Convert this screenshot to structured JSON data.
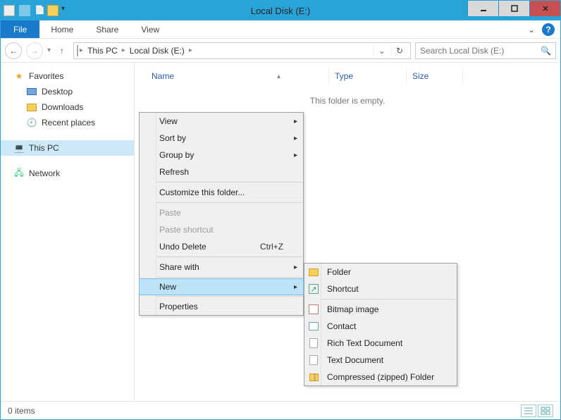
{
  "window": {
    "title": "Local Disk (E:)"
  },
  "ribbon": {
    "file": "File",
    "tabs": [
      "Home",
      "Share",
      "View"
    ]
  },
  "nav": {
    "crumbs": [
      "This PC",
      "Local Disk (E:)"
    ],
    "search_placeholder": "Search Local Disk (E:)"
  },
  "sidebar": {
    "favorites": {
      "label": "Favorites",
      "items": [
        "Desktop",
        "Downloads",
        "Recent places"
      ]
    },
    "thispc": {
      "label": "This PC"
    },
    "network": {
      "label": "Network"
    }
  },
  "columns": {
    "name": "Name",
    "type": "Type",
    "size": "Size"
  },
  "content": {
    "empty": "This folder is empty."
  },
  "context": {
    "view": "View",
    "sortby": "Sort by",
    "groupby": "Group by",
    "refresh": "Refresh",
    "customize": "Customize this folder...",
    "paste": "Paste",
    "paste_shortcut": "Paste shortcut",
    "undo": "Undo Delete",
    "undo_accel": "Ctrl+Z",
    "sharewith": "Share with",
    "new": "New",
    "properties": "Properties"
  },
  "new_submenu": {
    "folder": "Folder",
    "shortcut": "Shortcut",
    "bitmap": "Bitmap image",
    "contact": "Contact",
    "rtf": "Rich Text Document",
    "txt": "Text Document",
    "zip": "Compressed (zipped) Folder"
  },
  "status": {
    "items": "0 items"
  }
}
